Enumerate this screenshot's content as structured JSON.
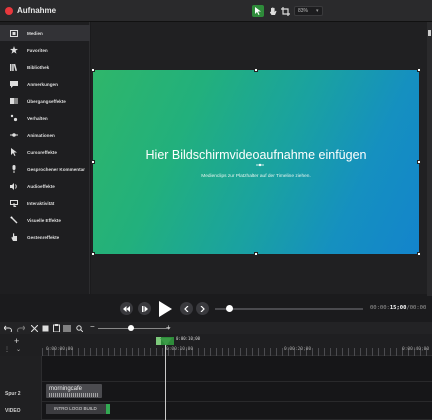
{
  "app": {
    "title": "Aufnahme"
  },
  "toolbar": {
    "zoom_value": "83%"
  },
  "sidebar": {
    "items": [
      {
        "label": "Medien",
        "icon": "film-icon",
        "active": true
      },
      {
        "label": "Favoriten",
        "icon": "star-icon"
      },
      {
        "label": "Bibliothek",
        "icon": "library-icon"
      },
      {
        "label": "Anmerkungen",
        "icon": "annotation-icon"
      },
      {
        "label": "Übergangseffekte",
        "icon": "transition-icon"
      },
      {
        "label": "Verhalten",
        "icon": "behavior-icon"
      },
      {
        "label": "Animationen",
        "icon": "animation-icon"
      },
      {
        "label": "Cursoreffekte",
        "icon": "cursor-icon"
      },
      {
        "label": "Gesprochener Kommentar",
        "icon": "microphone-icon"
      },
      {
        "label": "Audioeffekte",
        "icon": "speaker-icon"
      },
      {
        "label": "Interaktivität",
        "icon": "interactivity-icon"
      },
      {
        "label": "Visuelle Effekte",
        "icon": "wand-icon"
      },
      {
        "label": "Gestenreffekte",
        "icon": "hand-icon"
      }
    ]
  },
  "canvas": {
    "title": "Hier Bildschirmvideoaufnahme einfügen",
    "subtitle": "Medienclips zur Platzhalter auf der Timeline ziehen."
  },
  "playback": {
    "timecode_dim": "00:00:",
    "timecode_main": "15;00",
    "timecode_total": "/00:00",
    "position_fraction": 0.1
  },
  "timeline": {
    "ruler_labels": [
      "0:00:00;00",
      "0:00:10;00",
      "0:00:20;00",
      "0:00:40;00"
    ],
    "playhead_time": "0:00:10;00",
    "tracks": [
      {
        "name": "Spur 2",
        "clip": "morningcafe"
      },
      {
        "name": "VIDEO",
        "clip": "INTRO LOGO BUILD"
      }
    ]
  },
  "colors": {
    "accent_green": "#2e8b3a",
    "record_red": "#e8383d",
    "canvas_gradient_start": "#2fb66a",
    "canvas_gradient_end": "#1384cc"
  }
}
